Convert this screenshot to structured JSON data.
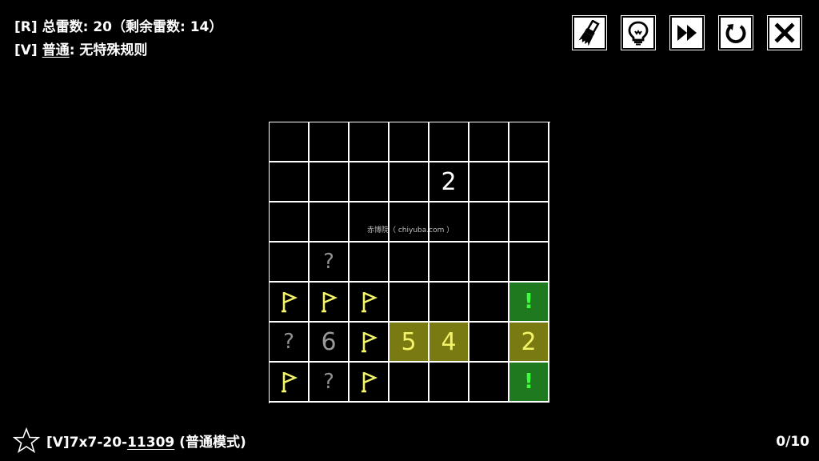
{
  "info": {
    "mine_line": {
      "tag": "[R]",
      "text": "总雷数:  20（剩余雷数: 14）"
    },
    "rule_line": {
      "tag": "[V]",
      "rule_name": "普通",
      "rule_desc": ": 无特殊规则"
    }
  },
  "toolbar": [
    {
      "name": "brush-icon",
      "label": "brush"
    },
    {
      "name": "lightbulb-icon",
      "label": "hint"
    },
    {
      "name": "fast-forward-icon",
      "label": "skip"
    },
    {
      "name": "restart-icon",
      "label": "restart"
    },
    {
      "name": "close-icon",
      "label": "close"
    }
  ],
  "board": {
    "rows": 7,
    "cols": 7,
    "cells": [
      [
        {
          "t": "empty"
        },
        {
          "t": "empty"
        },
        {
          "t": "empty"
        },
        {
          "t": "empty"
        },
        {
          "t": "empty"
        },
        {
          "t": "empty"
        },
        {
          "t": "empty"
        }
      ],
      [
        {
          "t": "empty"
        },
        {
          "t": "empty"
        },
        {
          "t": "empty"
        },
        {
          "t": "empty"
        },
        {
          "t": "num",
          "v": "2",
          "c": "white"
        },
        {
          "t": "empty"
        },
        {
          "t": "empty"
        }
      ],
      [
        {
          "t": "empty"
        },
        {
          "t": "empty"
        },
        {
          "t": "empty"
        },
        {
          "t": "empty"
        },
        {
          "t": "empty"
        },
        {
          "t": "empty"
        },
        {
          "t": "empty"
        }
      ],
      [
        {
          "t": "empty"
        },
        {
          "t": "q",
          "v": "?"
        },
        {
          "t": "empty"
        },
        {
          "t": "empty"
        },
        {
          "t": "empty"
        },
        {
          "t": "empty"
        },
        {
          "t": "empty"
        }
      ],
      [
        {
          "t": "flag"
        },
        {
          "t": "flag"
        },
        {
          "t": "flag"
        },
        {
          "t": "empty"
        },
        {
          "t": "empty"
        },
        {
          "t": "empty"
        },
        {
          "t": "excl",
          "v": "!",
          "bg": "green"
        }
      ],
      [
        {
          "t": "q",
          "v": "?"
        },
        {
          "t": "num",
          "v": "6",
          "c": "gray"
        },
        {
          "t": "flag"
        },
        {
          "t": "num",
          "v": "5",
          "c": "yellow",
          "bg": "yellow"
        },
        {
          "t": "num",
          "v": "4",
          "c": "yellow",
          "bg": "yellow"
        },
        {
          "t": "empty"
        },
        {
          "t": "num",
          "v": "2",
          "c": "yellow",
          "bg": "yellow"
        }
      ],
      [
        {
          "t": "flag"
        },
        {
          "t": "q",
          "v": "?"
        },
        {
          "t": "flag"
        },
        {
          "t": "empty"
        },
        {
          "t": "empty"
        },
        {
          "t": "empty"
        },
        {
          "t": "excl",
          "v": "!",
          "bg": "green"
        }
      ]
    ]
  },
  "watermark": "赤博院（ chiyuba.com ）",
  "footer": {
    "puzzle_prefix": "[V]7x7-20-",
    "puzzle_seed": "11309",
    "puzzle_mode": " (普通模式)",
    "progress": "0/10"
  },
  "colors": {
    "highlight_yellow": "#7a7a12",
    "highlight_green": "#1f7a1f",
    "flag": "#f4f46a",
    "excl": "#3cff3c"
  }
}
